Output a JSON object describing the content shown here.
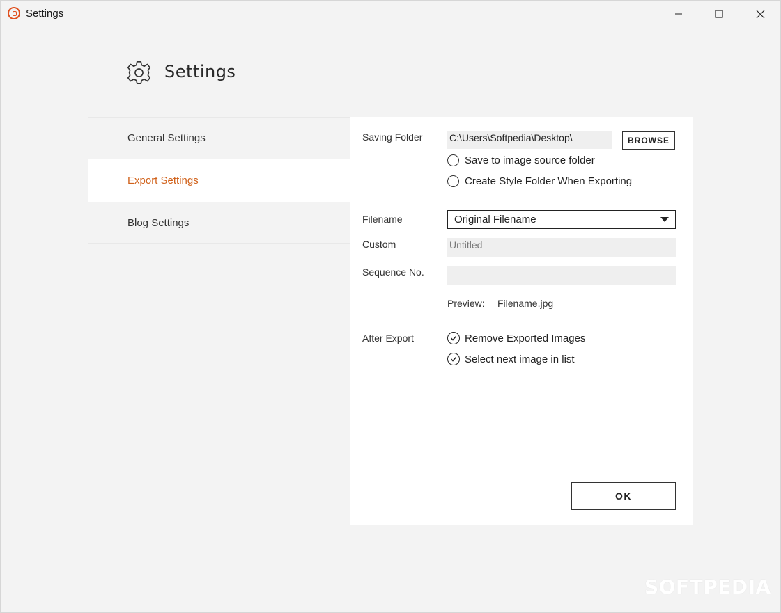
{
  "window": {
    "title": "Settings",
    "buttons": {
      "minimize": "minimize-icon",
      "maximize": "maximize-icon",
      "close": "close-icon"
    }
  },
  "header": {
    "title": "Settings",
    "icon": "gear-icon"
  },
  "sidebar": {
    "items": [
      {
        "label": "General Settings",
        "active": false
      },
      {
        "label": "Export Settings",
        "active": true
      },
      {
        "label": "Blog Settings",
        "active": false
      }
    ]
  },
  "export": {
    "saving_folder_label": "Saving Folder",
    "saving_folder_value": "C:\\Users\\Softpedia\\Desktop\\",
    "browse_label": "BROWSE",
    "save_to_source_label": "Save to image source folder",
    "create_style_folder_label": "Create Style Folder When Exporting",
    "filename_label": "Filename",
    "filename_selected": "Original Filename",
    "custom_label": "Custom",
    "custom_placeholder": "Untitled",
    "sequence_label": "Sequence No.",
    "sequence_value": "",
    "preview_label": "Preview:",
    "preview_value": "Filename.jpg",
    "after_export_label": "After Export",
    "remove_exported_label": "Remove Exported Images",
    "select_next_label": "Select next image in list",
    "ok_label": "OK"
  },
  "colors": {
    "accent": "#d0611a",
    "background": "#f3f3f3",
    "panel": "#ffffff"
  },
  "watermark": "SOFTPEDIA"
}
